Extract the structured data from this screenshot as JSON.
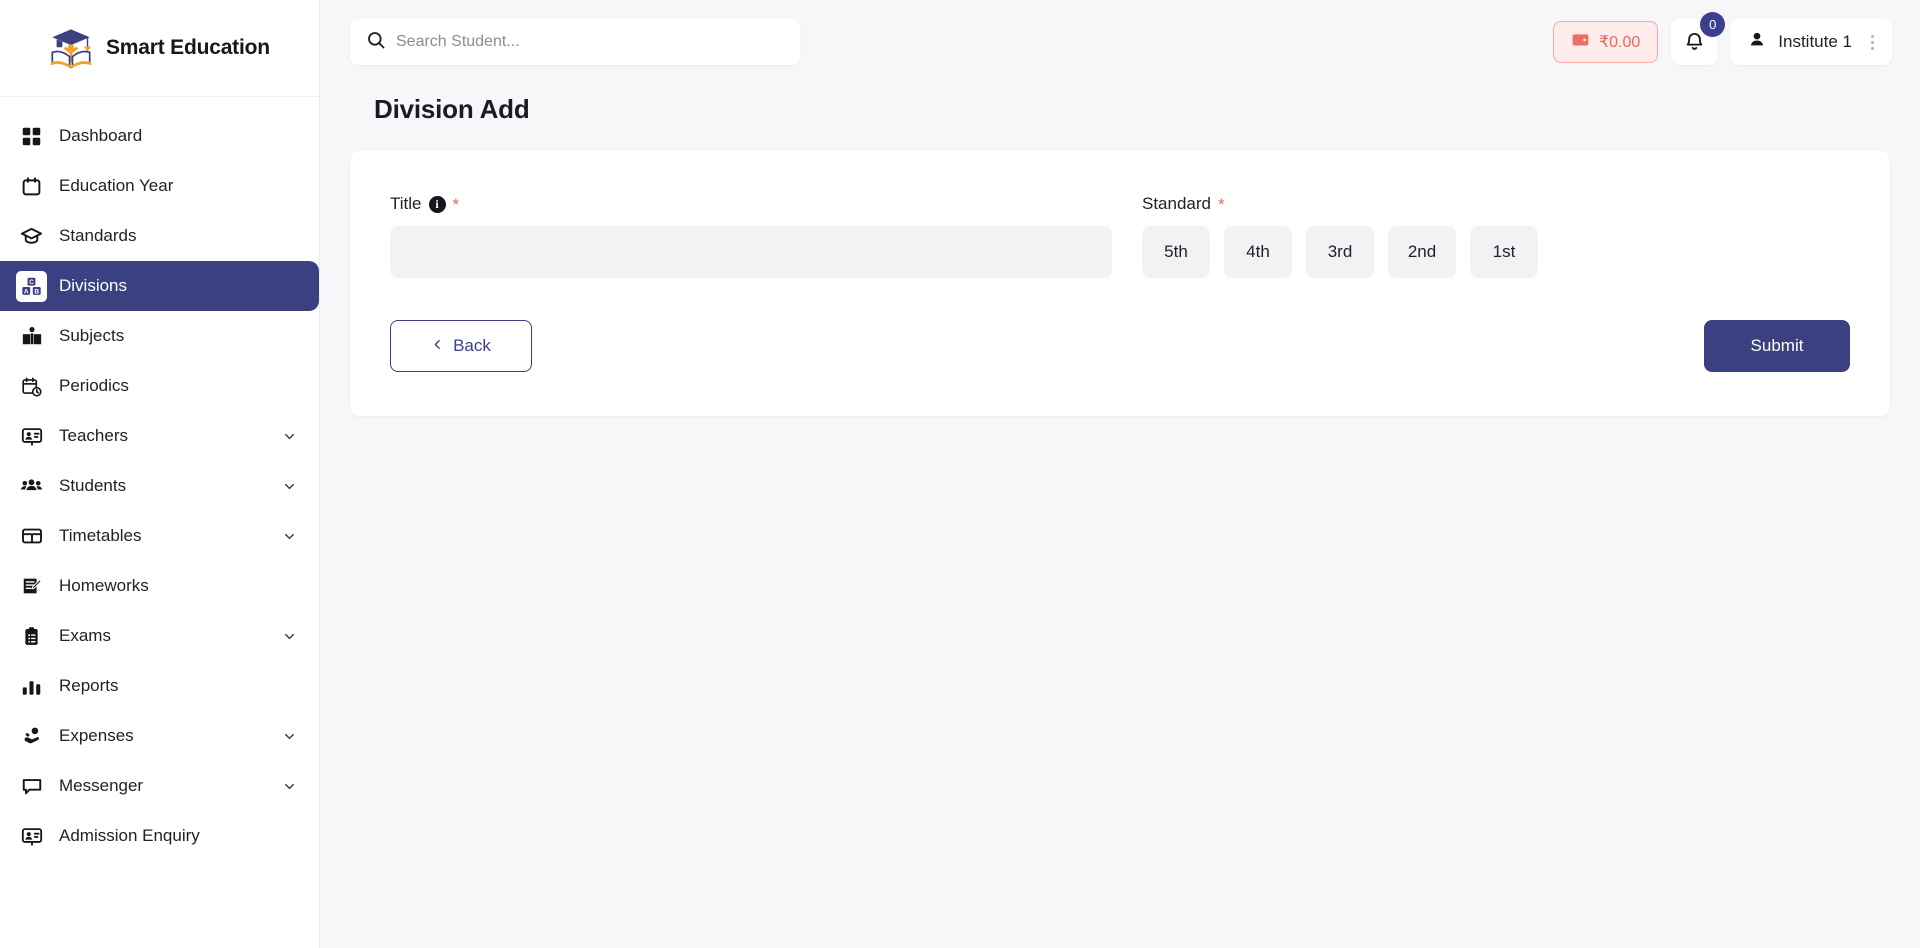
{
  "brand": {
    "name": "Smart Education",
    "logo_icon": "graduation-book-logo",
    "colors": {
      "primary": "#3b4180",
      "accent": "#f0a32a",
      "danger": "#e8685d"
    }
  },
  "sidebar": {
    "items": [
      {
        "label": "Dashboard",
        "icon": "grid-icon",
        "active": false,
        "expandable": false
      },
      {
        "label": "Education Year",
        "icon": "calendar-icon",
        "active": false,
        "expandable": false
      },
      {
        "label": "Standards",
        "icon": "graduation-cap-icon",
        "active": false,
        "expandable": false
      },
      {
        "label": "Divisions",
        "icon": "abc-blocks-icon",
        "active": true,
        "expandable": false
      },
      {
        "label": "Subjects",
        "icon": "open-book-icon",
        "active": false,
        "expandable": false
      },
      {
        "label": "Periodics",
        "icon": "calendar-clock-icon",
        "active": false,
        "expandable": false
      },
      {
        "label": "Teachers",
        "icon": "presenter-icon",
        "active": false,
        "expandable": true
      },
      {
        "label": "Students",
        "icon": "users-group-icon",
        "active": false,
        "expandable": true
      },
      {
        "label": "Timetables",
        "icon": "table-icon",
        "active": false,
        "expandable": true
      },
      {
        "label": "Homeworks",
        "icon": "note-edit-icon",
        "active": false,
        "expandable": false
      },
      {
        "label": "Exams",
        "icon": "clipboard-list-icon",
        "active": false,
        "expandable": true
      },
      {
        "label": "Reports",
        "icon": "bar-chart-icon",
        "active": false,
        "expandable": false
      },
      {
        "label": "Expenses",
        "icon": "hand-money-icon",
        "active": false,
        "expandable": true
      },
      {
        "label": "Messenger",
        "icon": "chat-bubble-icon",
        "active": false,
        "expandable": true
      },
      {
        "label": "Admission Enquiry",
        "icon": "presenter-icon",
        "active": false,
        "expandable": false
      }
    ]
  },
  "topbar": {
    "search": {
      "placeholder": "Search Student...",
      "value": "",
      "icon": "search-icon"
    },
    "wallet": {
      "amount": "₹0.00",
      "icon": "wallet-icon"
    },
    "notifications": {
      "count": "0",
      "icon": "bell-icon"
    },
    "user": {
      "name": "Institute 1",
      "icon": "user-icon",
      "menu_icon": "kebab-menu-icon"
    }
  },
  "page": {
    "title": "Division Add"
  },
  "form": {
    "title_field": {
      "label": "Title",
      "info_icon": "info-icon",
      "required_marker": "*",
      "value": "",
      "placeholder": ""
    },
    "standard_field": {
      "label": "Standard",
      "required_marker": "*",
      "options": [
        "5th",
        "4th",
        "3rd",
        "2nd",
        "1st"
      ],
      "selected": ""
    },
    "back_button": {
      "label": "Back",
      "icon": "chevron-left-icon"
    },
    "submit_button": {
      "label": "Submit"
    }
  }
}
